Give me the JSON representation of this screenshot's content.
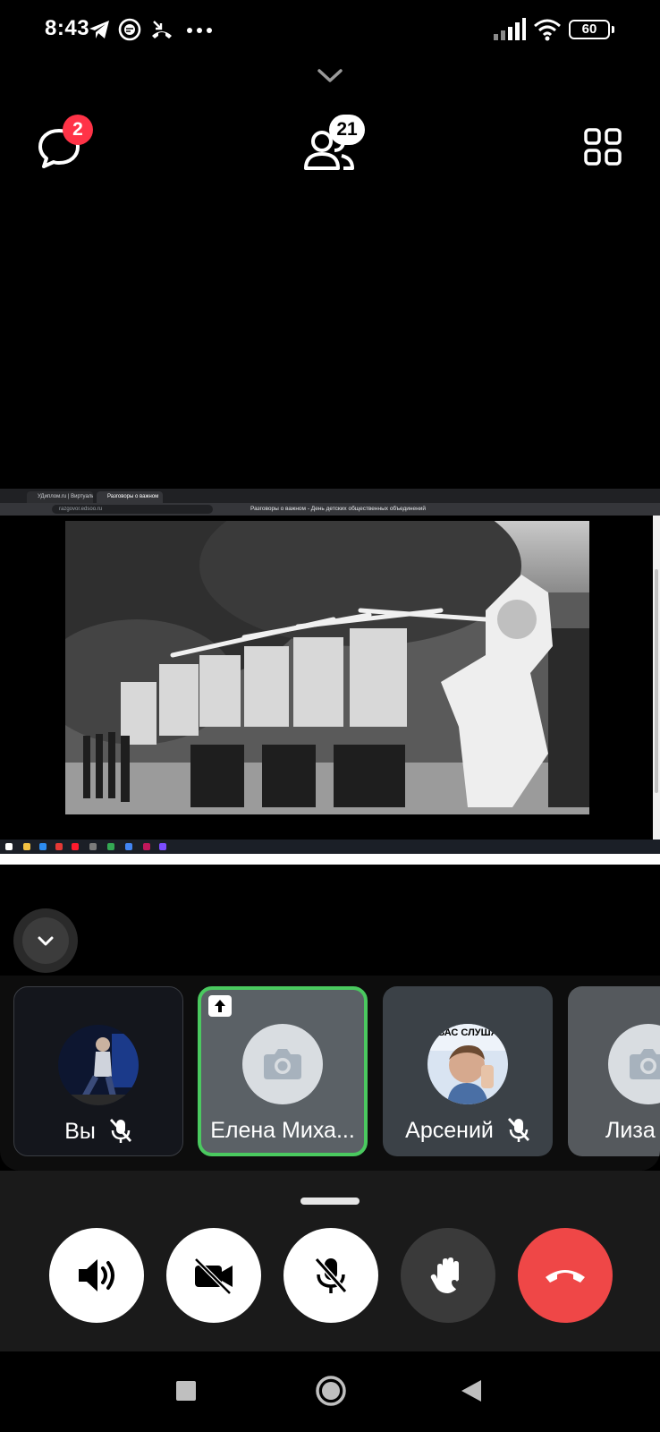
{
  "status_bar": {
    "time": "8:43",
    "battery": "60",
    "icons": [
      "telegram-icon",
      "chat-bubble-icon",
      "missed-call-icon",
      "more-dots-icon",
      "signal-icon",
      "wifi-icon",
      "battery-icon"
    ]
  },
  "top_actions": {
    "chat_badge": "2",
    "participants_badge": "21"
  },
  "shared_screen": {
    "tabs": [
      "УДиплом.ru | Виртуальн...",
      "Разговоры о важном"
    ],
    "url": "razgovor.edsoo.ru",
    "page_title": "Разговоры о важном - День детских общественных объединений"
  },
  "participants": [
    {
      "name": "Вы",
      "muted": true
    },
    {
      "name": "Елена Миха...",
      "muted": false,
      "speaking": true
    },
    {
      "name": "Арсений",
      "muted": true,
      "avatar_caption": "ВАС СЛУША"
    },
    {
      "name": "Лиза",
      "muted": false
    }
  ],
  "controls": [
    "speaker-button",
    "camera-off-button",
    "mic-off-button",
    "raise-hand-button",
    "end-call-button"
  ],
  "colors": {
    "speaking_border": "#4ac95f",
    "end_call": "#ef4747",
    "badge_red": "#ff3347"
  }
}
